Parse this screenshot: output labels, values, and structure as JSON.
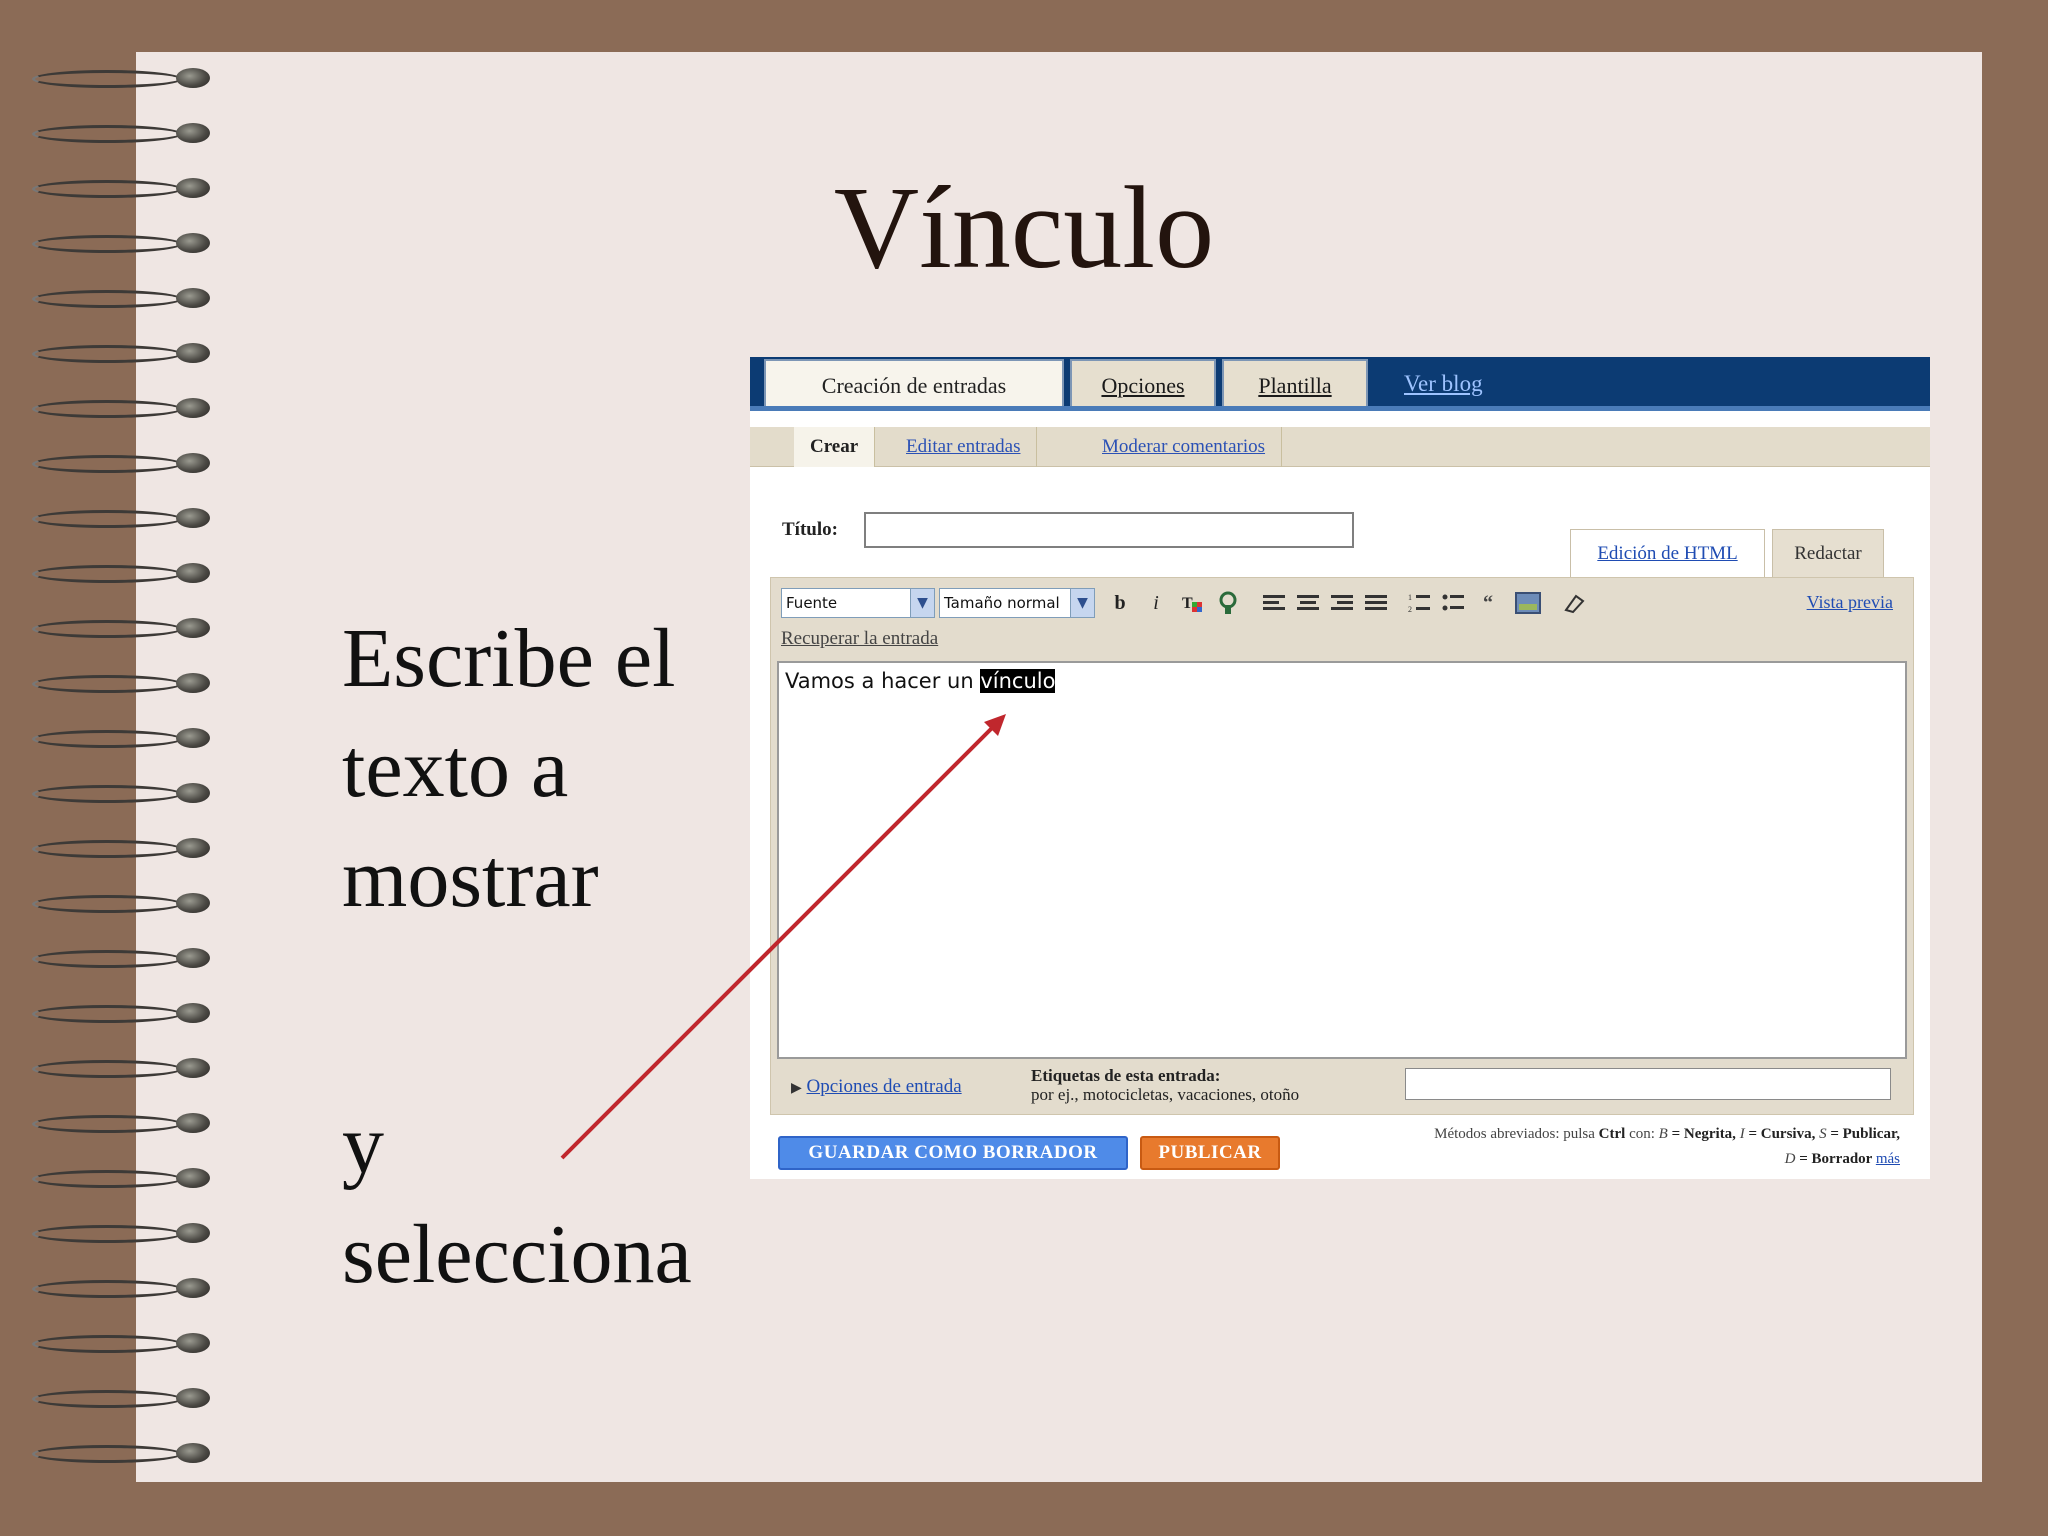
{
  "slide": {
    "title": "Vínculo",
    "instruction_lines": [
      "Escribe el",
      "texto a",
      "mostrar"
    ],
    "instruction_lines_2": [
      "y",
      "selecciona"
    ]
  },
  "blogger": {
    "tabs": [
      {
        "label": "Creación de entradas",
        "active": true
      },
      {
        "label": "Opciones",
        "active": false
      },
      {
        "label": "Plantilla",
        "active": false
      },
      {
        "label": "Ver blog",
        "active": false
      }
    ],
    "subtabs": [
      {
        "label": "Crear",
        "active": true
      },
      {
        "label": "Editar entradas",
        "active": false
      },
      {
        "label": "Moderar comentarios",
        "active": false
      }
    ],
    "title_label": "Título:",
    "title_value": "",
    "mode_tabs": {
      "html": "Edición de HTML",
      "compose": "Redactar"
    },
    "toolbar": {
      "font_select": "Fuente",
      "size_select": "Tamaño normal",
      "preview_link": "Vista previa",
      "icons": [
        "bold-icon",
        "italic-icon",
        "text-color-icon",
        "link-icon",
        "align-left-icon",
        "align-center-icon",
        "align-right-icon",
        "justify-icon",
        "numbered-list-icon",
        "bullet-list-icon",
        "blockquote-icon",
        "image-icon",
        "eraser-icon"
      ]
    },
    "recover_link": "Recuperar la entrada",
    "editor": {
      "text_before": "Vamos a hacer un ",
      "selected_text": "vínculo"
    },
    "post_options_link": "Opciones de entrada",
    "labels": {
      "title": "Etiquetas de esta entrada:",
      "hint": "por ej., motocicletas, vacaciones, otoño"
    },
    "buttons": {
      "save_draft": "GUARDAR COMO BORRADOR",
      "publish": "PUBLICAR"
    },
    "shortcuts": {
      "prefix": "Métodos abreviados: pulsa ",
      "ctrl": "Ctrl",
      "con": " con: ",
      "b_key": "B",
      "b_desc": " = Negrita, ",
      "i_key": "I",
      "i_desc": " = Cursiva, ",
      "s_key": "S",
      "s_desc": " = Publicar,",
      "d_key": "D",
      "d_desc": " = Borrador ",
      "more": "más"
    }
  },
  "colors": {
    "background": "#8b6b56",
    "page": "#efe6e3",
    "header_bar": "#0c3b73",
    "arrow": "#c0272d",
    "publish": "#e87a2d",
    "save": "#4f8be8"
  }
}
